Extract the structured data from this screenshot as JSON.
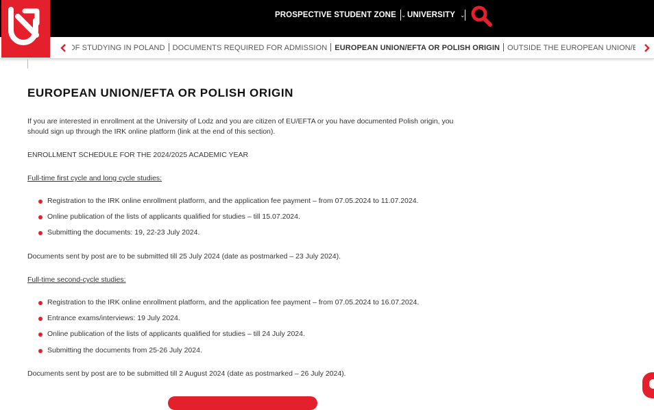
{
  "brand": {
    "accent": "#e3202b",
    "topbar_bg": "#000000"
  },
  "header": {
    "logo_icon": "university-logo-arrow-icon",
    "nav": [
      {
        "label": "PROSPECTIVE STUDENT ZONE",
        "icon": "chevron-down-icon"
      },
      {
        "label": "UNIVERSITY",
        "icon": "chevron-down-icon"
      }
    ],
    "search_icon": "search-icon"
  },
  "subnav": {
    "prev_icon": "chevron-left-icon",
    "next_icon": "chevron-right-icon",
    "items": [
      {
        "label": "OF STUDYING IN POLAND",
        "active": false
      },
      {
        "label": "DOCUMENTS REQUIRED FOR ADMISSION",
        "active": false
      },
      {
        "label": "EUROPEAN UNION/EFTA OR POLISH ORIGIN",
        "active": true
      },
      {
        "label": "OUTSIDE THE EUROPEAN UNION/EFTA",
        "active": false
      }
    ]
  },
  "main": {
    "title": "EUROPEAN UNION/EFTA OR POLISH ORIGIN",
    "intro": "If you are interested in enrollment at the University of Lodz and you are citizen of EU/EFTA or you have documented Polish origin, you should sign up through the IRK online platform (link at the end of this section).",
    "schedule_heading": "ENROLLMENT SCHEDULE FOR THE 2024/2025 ACADEMIC YEAR",
    "first_cycle": {
      "heading": "Full-time first cycle and long cycle studies:",
      "items": [
        "Registration to the IRK online enrollment platform, and the application fee payment –  from 07.05.2024 to 11.07.2024.",
        "Online publication of the lists of applicants qualified for studies – till 15.07.2024.",
        "Submitting the documents: 19, 22-23 July 2024."
      ],
      "note": "Documents sent by post are to be submitted till 25 July 2024 (date as postmarked – 23 July 2024)."
    },
    "second_cycle": {
      "heading": "Full-time second-cycle studies:",
      "items": [
        "Registration to the IRK online enrollment platform, and the application fee payment –  from 07.05.2024 to 16.07.2024.",
        "Entrance exams/interviews: 19 July 2024.",
        "Online publication of the lists of applicants qualified for studies – till 24 July 2024.",
        "Submitting the documents from 25-26 July 2024."
      ],
      "note": "Documents sent by post are to be submitted till 2 August 2024 (date as postmarked – 26 July 2024)."
    }
  },
  "widgets": {
    "chat_icon": "chat-bubble-icon"
  }
}
